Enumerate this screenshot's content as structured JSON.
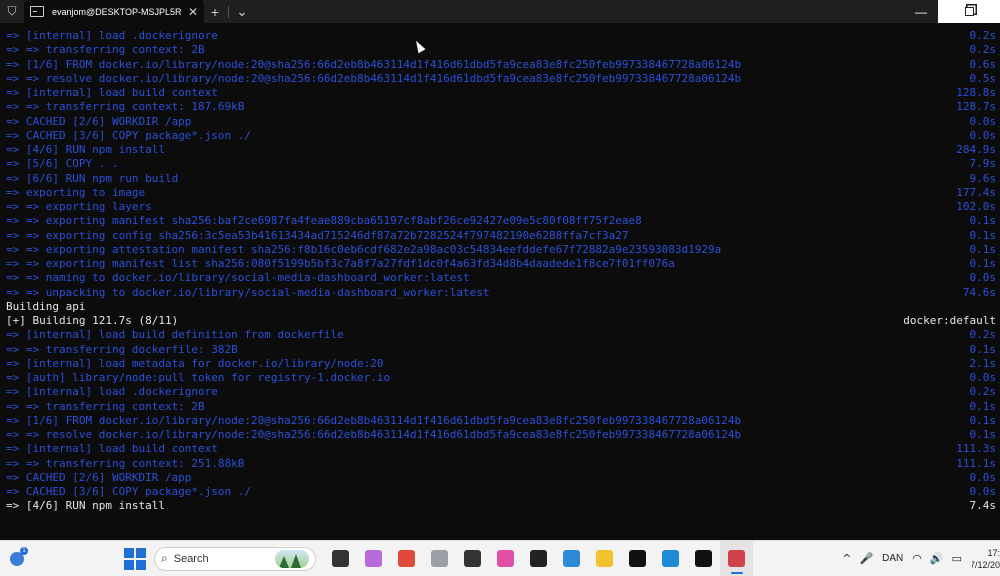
{
  "window": {
    "tab_title": "evanjom@DESKTOP-MSJPL5R",
    "tab_close": "✕",
    "new_tab": "+",
    "dropdown": "⌄",
    "minimize": "—"
  },
  "terminal_lines": [
    {
      "text": "=> [internal] load .dockerignore",
      "time": "0.2s",
      "color": "blue"
    },
    {
      "text": "=> => transferring context: 2B",
      "time": "0.2s",
      "color": "blue"
    },
    {
      "text": "=> [1/6] FROM docker.io/library/node:20@sha256:66d2eb8b463114d1f416d61dbd5fa9cea83e8fc250feb997338467728a06124b",
      "time": "0.6s",
      "color": "blue"
    },
    {
      "text": "=> => resolve docker.io/library/node:20@sha256:66d2eb8b463114d1f416d61dbd5fa9cea83e8fc250feb997338467728a06124b",
      "time": "0.5s",
      "color": "blue"
    },
    {
      "text": "=> [internal] load build context",
      "time": "128.8s",
      "color": "blue"
    },
    {
      "text": "=> => transferring context: 187.69kB",
      "time": "128.7s",
      "color": "blue"
    },
    {
      "text": "=> CACHED [2/6] WORKDIR /app",
      "time": "0.0s",
      "color": "blue"
    },
    {
      "text": "=> CACHED [3/6] COPY package*.json ./",
      "time": "0.0s",
      "color": "blue"
    },
    {
      "text": "=> [4/6] RUN npm install",
      "time": "284.9s",
      "color": "blue"
    },
    {
      "text": "=> [5/6] COPY . .",
      "time": "7.9s",
      "color": "blue"
    },
    {
      "text": "=> [6/6] RUN npm run build",
      "time": "9.6s",
      "color": "blue"
    },
    {
      "text": "=> exporting to image",
      "time": "177.4s",
      "color": "blue"
    },
    {
      "text": "=> => exporting layers",
      "time": "102.0s",
      "color": "blue"
    },
    {
      "text": "=> => exporting manifest sha256:baf2ce6987fa4feae889cba65197cf8abf26ce92427e09e5c80f08ff75f2eae8",
      "time": "0.1s",
      "color": "blue"
    },
    {
      "text": "=> => exporting config sha256:3c5ea53b41613434ad715246df87a72b7282524f797482190e6288ffa7cf3a27",
      "time": "0.1s",
      "color": "blue"
    },
    {
      "text": "=> => exporting attestation manifest sha256:f8b16c0eb6cdf682e2a98ac03c54834eefddefe67f72882a9e23593083d1929a",
      "time": "0.1s",
      "color": "blue"
    },
    {
      "text": "=> => exporting manifest list sha256:080f5199b5bf3c7a8f7a27fdf1dc0f4a63fd34d8b4daadede1f8ce7f01ff076a",
      "time": "0.1s",
      "color": "blue"
    },
    {
      "text": "=> => naming to docker.io/library/social-media-dashboard_worker:latest",
      "time": "0.0s",
      "color": "blue"
    },
    {
      "text": "=> => unpacking to docker.io/library/social-media-dashboard_worker:latest",
      "time": "74.6s",
      "color": "blue"
    },
    {
      "text": "Building api",
      "time": "",
      "color": "white"
    },
    {
      "text": "[+] Building 121.7s (8/11)",
      "time": "docker:default",
      "color": "white"
    },
    {
      "text": "=> [internal] load build definition from dockerfile",
      "time": "0.2s",
      "color": "blue"
    },
    {
      "text": "=> => transferring dockerfile: 382B",
      "time": "0.1s",
      "color": "blue"
    },
    {
      "text": "=> [internal] load metadata for docker.io/library/node:20",
      "time": "2.1s",
      "color": "blue"
    },
    {
      "text": "=> [auth] library/node:pull token for registry-1.docker.io",
      "time": "0.0s",
      "color": "blue"
    },
    {
      "text": "=> [internal] load .dockerignore",
      "time": "0.2s",
      "color": "blue"
    },
    {
      "text": "=> => transferring context: 2B",
      "time": "0.1s",
      "color": "blue"
    },
    {
      "text": "=> [1/6] FROM docker.io/library/node:20@sha256:66d2eb8b463114d1f416d61dbd5fa9cea83e8fc250feb997338467728a06124b",
      "time": "0.1s",
      "color": "blue"
    },
    {
      "text": "=> => resolve docker.io/library/node:20@sha256:66d2eb8b463114d1f416d61dbd5fa9cea83e8fc250feb997338467728a06124b",
      "time": "0.1s",
      "color": "blue"
    },
    {
      "text": "=> [internal] load build context",
      "time": "111.3s",
      "color": "blue"
    },
    {
      "text": "=> => transferring context: 251.88kB",
      "time": "111.1s",
      "color": "blue"
    },
    {
      "text": "=> CACHED [2/6] WORKDIR /app",
      "time": "0.0s",
      "color": "blue"
    },
    {
      "text": "=> CACHED [3/6] COPY package*.json ./",
      "time": "0.0s",
      "color": "blue"
    },
    {
      "text": "=> [4/6] RUN npm install",
      "time": "7.4s",
      "color": "white"
    }
  ],
  "taskbar": {
    "weather_badge": "1",
    "search_placeholder": "Search",
    "apps": [
      {
        "name": "task-view-icon",
        "color": "#333333"
      },
      {
        "name": "copilot-icon",
        "color": "#b86bd8"
      },
      {
        "name": "chrome-icon",
        "color": "#e04a3a"
      },
      {
        "name": "alarm-icon",
        "color": "#9aa0a6"
      },
      {
        "name": "notepad-icon",
        "color": "#333333"
      },
      {
        "name": "color-picker-icon",
        "color": "#e24fa6"
      },
      {
        "name": "terminal-icon",
        "color": "#222222"
      },
      {
        "name": "edge-icon",
        "color": "#2c8ad6"
      },
      {
        "name": "file-explorer-icon",
        "color": "#f2c12e"
      },
      {
        "name": "media-player-icon",
        "color": "#111111"
      },
      {
        "name": "vscode-icon",
        "color": "#1f8ad6"
      },
      {
        "name": "tiktok-icon",
        "color": "#111111"
      },
      {
        "name": "snipping-tool-icon",
        "color": "#d0424a"
      }
    ],
    "tray": {
      "chevron": "^",
      "language": "DAN",
      "wifi": "◠",
      "volume": "🔊",
      "battery": "▭",
      "time": "17:",
      "date": "07/12/20"
    }
  }
}
